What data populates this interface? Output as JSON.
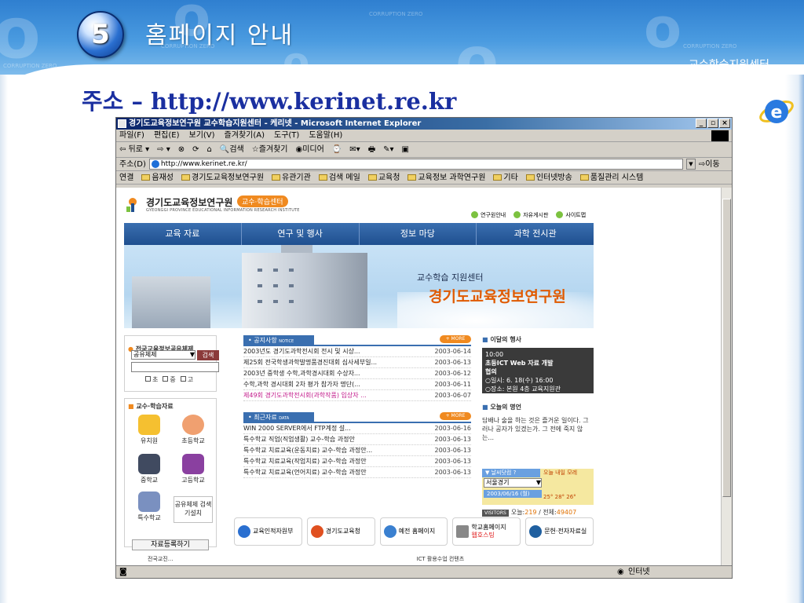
{
  "slide": {
    "step_number": "5",
    "title": "홈페이지 안내",
    "corner_label": "교수학습지원센터",
    "address_prefix": "주소 – ",
    "address_url": "http://www.kerinet.re.kr",
    "bg_text": "CORRUPTION ZERO"
  },
  "browser": {
    "window_title": "경기도교육정보연구원 교수학습지원센터 - 케리넷 - Microsoft Internet Explorer",
    "menu": [
      "파일(F)",
      "편집(E)",
      "보기(V)",
      "즐겨찾기(A)",
      "도구(T)",
      "도움말(H)"
    ],
    "toolbar": [
      "⇦ 뒤로 ▾",
      "⇨ ▾",
      "⊗",
      "⟳",
      "⌂",
      "🔍검색",
      "☆즐겨찾기",
      "◉미디어",
      "⌚",
      "✉▾",
      "🖶",
      "✎▾",
      "▣"
    ],
    "address_label": "주소(D)",
    "address_value": "http://www.kerinet.re.kr/",
    "go_label": "⇨이동",
    "links_label": "연결",
    "links": [
      "음재성",
      "경기도교육정보연구원",
      "유관기관",
      "검색 메일",
      "교육청",
      "교육정보 과학연구원",
      "기타",
      "인터넷방송",
      "품질관리 시스템"
    ],
    "status_text": "인터넷"
  },
  "site": {
    "name": "경기도교육정보연구원",
    "name_en": "GYEONGGI PROVINCE EDUCATIONAL INFORMATION RESEARCH INSTITUTE",
    "tag": "교수·학습센터",
    "top_links": [
      "연구원안내",
      "자유게시판",
      "사이트맵"
    ],
    "nav": [
      "교육 자료",
      "연구 및 행사",
      "정보 마당",
      "과학 전시관"
    ],
    "banner_sub": "교수학습 지원센터",
    "banner_main": "경기도교육정보연구원",
    "search": {
      "title": "전국교육정보공유체제",
      "select_value": "공유체제",
      "button": "검색",
      "checks": [
        "초",
        "중",
        "고"
      ]
    },
    "teacher": {
      "title": "교수·학습자료",
      "items": [
        "유치원",
        "초등학교",
        "중학교",
        "고등학교",
        "특수학교",
        "공유체제 검색기설치"
      ],
      "register_button": "자료등록하기"
    },
    "notice": {
      "tab": "공지사항",
      "tab_en": "NOTICE",
      "more": "+ MORE",
      "rows": [
        {
          "title": "2003년도 경기도과학전시회 전시 및 시상...",
          "date": "2003-06-14"
        },
        {
          "title": "제25회 전국학생과학발명품경진대회 심사세부일...",
          "date": "2003-06-13"
        },
        {
          "title": "2003년 중학생 수학,과학경시대회 수상자...",
          "date": "2003-06-12"
        },
        {
          "title": "수학,과학 경시대회 2차 평가 참가자 명단(...",
          "date": "2003-06-11"
        },
        {
          "title": "제49회 경기도과학전시회(과학작품) 입상자 ...",
          "date": "2003-06-07"
        }
      ]
    },
    "recent": {
      "tab": "최근자료",
      "tab_en": "DATA",
      "more": "+ MORE",
      "rows": [
        {
          "title": "WIN 2000 SERVER에서 FTP계정 설...",
          "date": "2003-06-16"
        },
        {
          "title": "특수학교 직업(직업생활) 교수-학습 과정안",
          "date": "2003-06-13"
        },
        {
          "title": "특수학교 치료교육(운동치료) 교수-학습 과정안...",
          "date": "2003-06-13"
        },
        {
          "title": "특수학교 치료교육(작업치료) 교수-학습 과정안",
          "date": "2003-06-13"
        },
        {
          "title": "특수학교 치료교육(언어치료) 교수-학습 과정안",
          "date": "2003-06-13"
        }
      ]
    },
    "event": {
      "title": "이달의 행사",
      "line1": "10:00",
      "line2": "초등ICT Web 자료 개발",
      "line3": "협의",
      "line4": "○일시: 6. 18(수) 16:00",
      "line5": "○장소: 본원 4층 교육지원관"
    },
    "saying": {
      "title": "오늘의 명언",
      "text": "담배나 술을 하는 것은 즐거운 일이다. 그러나 공자가 있겠는가. 그 전에 죽지 않는..."
    },
    "weather": {
      "title": "▼ 날씨닷컴 ?",
      "tabs": "오늘  내일  모레",
      "region": "서울경기",
      "date": "2003/06/16 (월)",
      "temps": "25°   28°   26°"
    },
    "visitors": {
      "badge": "VISITORS",
      "today_label": "오늘:",
      "today": "219",
      "total_label": " / 전체:",
      "total": "49407"
    },
    "banners": [
      {
        "label": "교육인적자원부",
        "color": "#2a6fd0"
      },
      {
        "label": "경기도교육청",
        "color": "#e05020"
      },
      {
        "label": "예전 홈페이지",
        "color": "#3a80d0"
      },
      {
        "label": "학교홈페이지",
        "label2": "웹호스팅",
        "color": "#888888"
      },
      {
        "label": "문헌·전자자료실",
        "color": "#2060a0"
      }
    ],
    "bottom_items": [
      "전국교진...",
      "ICT 활용수업 컨텐츠"
    ]
  },
  "colors": {
    "header_blue": "#2f7fd0",
    "address_blue": "#1a2fa0",
    "nav_blue": "#1f4f8f",
    "accent_orange": "#f08a20"
  }
}
